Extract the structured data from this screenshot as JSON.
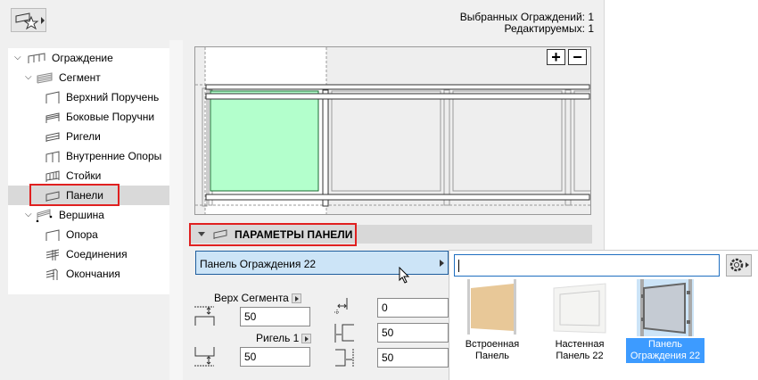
{
  "tree": {
    "items": [
      {
        "label": "Ограждение",
        "level": 0,
        "expanded": true
      },
      {
        "label": "Сегмент",
        "level": 1,
        "expanded": true
      },
      {
        "label": "Верхний Поручень",
        "level": 2
      },
      {
        "label": "Боковые Поручни",
        "level": 2
      },
      {
        "label": "Ригели",
        "level": 2
      },
      {
        "label": "Внутренние Опоры",
        "level": 2
      },
      {
        "label": "Стойки",
        "level": 2
      },
      {
        "label": "Панели",
        "level": 2,
        "selected": true
      },
      {
        "label": "Вершина",
        "level": 1,
        "expanded": true
      },
      {
        "label": "Опора",
        "level": 2
      },
      {
        "label": "Соединения",
        "level": 2
      },
      {
        "label": "Окончания",
        "level": 2
      }
    ]
  },
  "info": {
    "selected": "Выбранных Ограждений: 1",
    "editable": "Редактируемых: 1"
  },
  "preview": {
    "zoom_in": "+",
    "zoom_out": "−",
    "highlight_color": "#b3ffcc"
  },
  "section": {
    "title": "ПАРАМЕТРЫ ПАНЕЛИ"
  },
  "dropdown": {
    "value": "Панель Ограждения 22"
  },
  "params": {
    "top_label": "Верх Сегмента",
    "top_value": "50",
    "rail_label": "Ригель 1",
    "rail_value": "50",
    "offset_value": "0",
    "left_value": "50",
    "right_value": "50"
  },
  "popup": {
    "search_value": "",
    "items": [
      {
        "label": "Встроенная Панель",
        "line1": "Встроенная",
        "line2": "Панель"
      },
      {
        "label": "Настенная Панель 22",
        "line1": "Настенная",
        "line2": "Панель 22"
      },
      {
        "label": "Панель Ограждения 22",
        "line1": "Панель",
        "line2": "Ограждения 22",
        "selected": true
      }
    ]
  },
  "colors": {
    "selection": "#3d9bff",
    "accent_red": "#e02020"
  }
}
